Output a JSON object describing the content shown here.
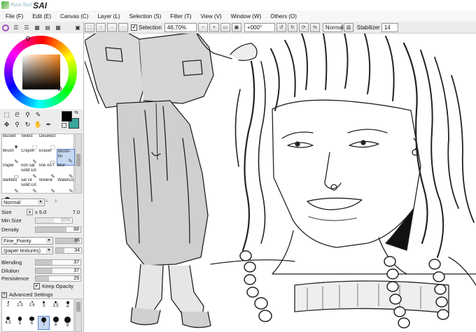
{
  "app": {
    "logo_small": "Paint Tool",
    "logo_big": "SAI"
  },
  "menu": [
    {
      "label": "File (F)"
    },
    {
      "label": "Edit (E)"
    },
    {
      "label": "Canvas (C)"
    },
    {
      "label": "Layer (L)"
    },
    {
      "label": "Selection (S)"
    },
    {
      "label": "Filter (T)"
    },
    {
      "label": "View (V)"
    },
    {
      "label": "Window (W)"
    },
    {
      "label": "Others (O)"
    }
  ],
  "toolbar": {
    "selection_label": "Selection",
    "selection_checked": true,
    "zoom": "46.70%",
    "rotation": "+000°",
    "blend_mode": "Normal",
    "stabilizer_label": "Stabilizer",
    "stabilizer_value": "14"
  },
  "colors": {
    "primary": "#000000",
    "secondary": "#3aa59a"
  },
  "brushes": [
    {
      "label": "Bucket"
    },
    {
      "label": "Select"
    },
    {
      "label": "Deselect"
    },
    {
      "label": ""
    },
    {
      "label": "Brush"
    },
    {
      "label": "Crayon"
    },
    {
      "label": "Eraser"
    },
    {
      "label": "Brush-lin",
      "selected": true
    },
    {
      "label": "Paper"
    },
    {
      "label": "non sat solid col"
    },
    {
      "label": "line no t"
    },
    {
      "label": "Blur"
    },
    {
      "label": "darkbru"
    },
    {
      "label": "sat cir solid col"
    },
    {
      "label": "fineline"
    },
    {
      "label": "WaterCo"
    }
  ],
  "properties": {
    "mode": "Normal",
    "size_label": "Size",
    "size_mult": "x 5.0",
    "size_value": "7.0",
    "min_size_label": "Min Size",
    "min_size_value": "50%",
    "density_label": "Density",
    "density_value": "68",
    "shape": "Fine_Pointy",
    "shape_value": "86",
    "texture": "(paper textures)",
    "texture_value": "34",
    "blending_label": "Blending",
    "blending_value": "37",
    "dilution_label": "Dilution",
    "dilution_value": "37",
    "persistence_label": "Persistence",
    "persistence_value": "29",
    "keep_opacity_label": "Keep Opacity",
    "advanced_label": "Advanced Settings"
  },
  "brush_sizes": [
    "2",
    "2.3",
    "2.6",
    "3",
    "3.5",
    "4",
    "4.5",
    "5",
    "6",
    "7",
    "8",
    "9"
  ]
}
